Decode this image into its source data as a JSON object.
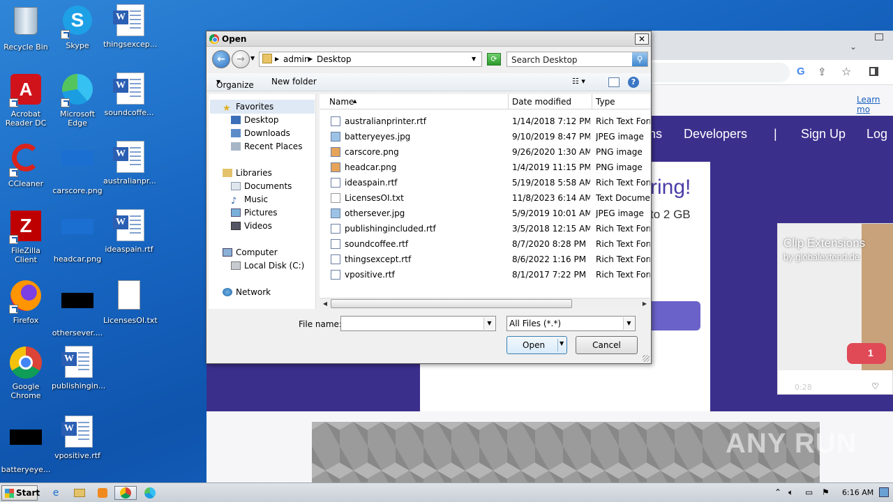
{
  "desktop": {
    "icons": [
      {
        "label": "Recycle Bin",
        "icon": "recycle-bin-icon"
      },
      {
        "label": "Skype",
        "icon": "skype-icon"
      },
      {
        "label": "thingsexcep...",
        "icon": "word-document-icon"
      },
      {
        "label": "Acrobat Reader DC",
        "icon": "acrobat-icon"
      },
      {
        "label": "Microsoft Edge",
        "icon": "edge-icon"
      },
      {
        "label": "soundcoffe...",
        "icon": "word-document-icon"
      },
      {
        "label": "CCleaner",
        "icon": "ccleaner-icon"
      },
      {
        "label": "carscore.png",
        "icon": "image-file-icon"
      },
      {
        "label": "australianpr...",
        "icon": "word-document-icon"
      },
      {
        "label": "FileZilla Client",
        "icon": "filezilla-icon"
      },
      {
        "label": "headcar.png",
        "icon": "image-file-icon"
      },
      {
        "label": "ideaspain.rtf",
        "icon": "word-document-icon"
      },
      {
        "label": "Firefox",
        "icon": "firefox-icon"
      },
      {
        "label": "othersever....",
        "icon": "image-file-icon"
      },
      {
        "label": "LicensesOI.txt",
        "icon": "text-file-icon"
      },
      {
        "label": "Google Chrome",
        "icon": "chrome-icon"
      },
      {
        "label": "publishingin...",
        "icon": "word-document-icon"
      },
      {
        "label": "batteryeye...",
        "icon": "image-file-icon"
      },
      {
        "label": "vpositive.rtf",
        "icon": "word-document-icon"
      }
    ]
  },
  "browser": {
    "learn_more": "Learn mo",
    "nav": [
      "ns",
      "Developers",
      "|",
      "Sign Up",
      "Log"
    ],
    "hero_title": "ring!",
    "hero_sub": "to 2 GB",
    "ad_title": "Clip Extensions",
    "ad_sub": "by globalextend.de",
    "ad_time": "0:28",
    "comment_count": "1"
  },
  "dialog": {
    "title": "Open",
    "breadcrumb": [
      "admin",
      "Desktop"
    ],
    "search_placeholder": "Search Desktop",
    "toolbar": {
      "organize": "Organize",
      "new_folder": "New folder"
    },
    "nav_pane": {
      "favorites": "Favorites",
      "favorites_items": [
        "Desktop",
        "Downloads",
        "Recent Places"
      ],
      "libraries": "Libraries",
      "libraries_items": [
        "Documents",
        "Music",
        "Pictures",
        "Videos"
      ],
      "computer": "Computer",
      "computer_items": [
        "Local Disk (C:)"
      ],
      "network": "Network"
    },
    "columns": {
      "name": "Name",
      "date": "Date modified",
      "type": "Type"
    },
    "files": [
      {
        "name": "australianprinter.rtf",
        "date": "1/14/2018 7:12 PM",
        "type": "Rich Text Forma"
      },
      {
        "name": "batteryeyes.jpg",
        "date": "9/10/2019 8:47 PM",
        "type": "JPEG image"
      },
      {
        "name": "carscore.png",
        "date": "9/26/2020 1:30 AM",
        "type": "PNG image"
      },
      {
        "name": "headcar.png",
        "date": "1/4/2019 11:15 PM",
        "type": "PNG image"
      },
      {
        "name": "ideaspain.rtf",
        "date": "5/19/2018 5:58 AM",
        "type": "Rich Text Forma"
      },
      {
        "name": "LicensesOI.txt",
        "date": "11/8/2023 6:14 AM",
        "type": "Text Document"
      },
      {
        "name": "othersever.jpg",
        "date": "5/9/2019 10:01 AM",
        "type": "JPEG image"
      },
      {
        "name": "publishingincluded.rtf",
        "date": "3/5/2018 12:15 AM",
        "type": "Rich Text Forma"
      },
      {
        "name": "soundcoffee.rtf",
        "date": "8/7/2020 8:28 PM",
        "type": "Rich Text Forma"
      },
      {
        "name": "thingsexcept.rtf",
        "date": "8/6/2022 1:16 PM",
        "type": "Rich Text Forma"
      },
      {
        "name": "vpositive.rtf",
        "date": "8/1/2017 7:22 PM",
        "type": "Rich Text Forma"
      }
    ],
    "file_name_label": "File name:",
    "file_name_value": "",
    "filter_value": "All Files (*.*)",
    "open_label": "Open",
    "cancel_label": "Cancel"
  },
  "taskbar": {
    "start_label": "Start",
    "clock": "6:16 AM"
  },
  "watermark": "ANY RUN"
}
